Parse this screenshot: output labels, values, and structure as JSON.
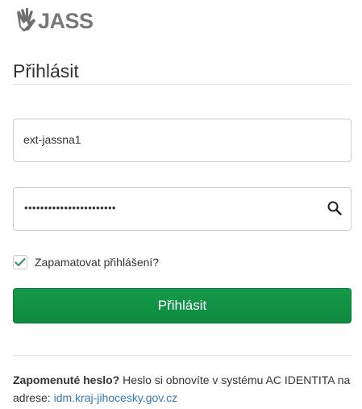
{
  "logo": {
    "text": "JASS",
    "icon": "hands-logo-icon"
  },
  "form": {
    "title": "Přihlásit",
    "username": {
      "value": "ext-jassna1"
    },
    "password": {
      "masked_value": "•••••••••••••••••••••••",
      "icon": "search-icon"
    },
    "remember": {
      "label": "Zapamatovat přihlášení?",
      "checked": true
    },
    "submit_label": "Přihlásit"
  },
  "footer": {
    "forgot_label": "Zapomenuté heslo?",
    "forgot_text": " Heslo si obnovíte v systému AC IDENTITA na adrese: ",
    "link_text": "idm.kraj-jihocesky.gov.cz"
  },
  "colors": {
    "primary": "#13924a",
    "link": "#337ab7",
    "check": "#3c9a5f"
  }
}
